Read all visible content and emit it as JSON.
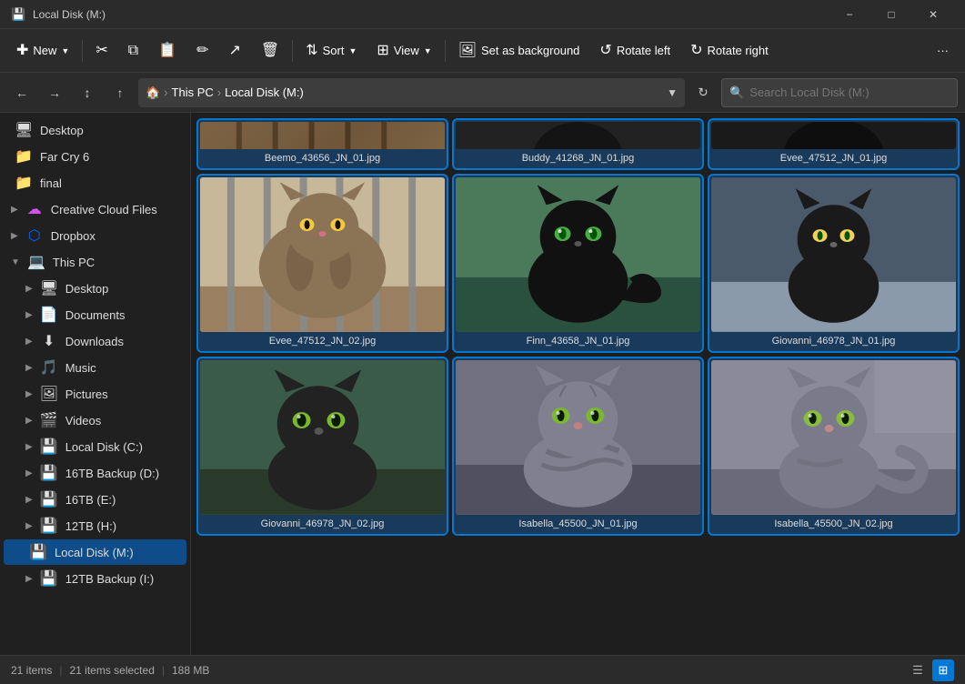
{
  "window": {
    "title": "Local Disk (M:)",
    "icon": "💾"
  },
  "titlebar": {
    "minimize": "−",
    "maximize": "□",
    "close": "✕"
  },
  "toolbar": {
    "new_label": "New",
    "sort_label": "Sort",
    "view_label": "View",
    "set_bg_label": "Set as background",
    "rotate_left_label": "Rotate left",
    "rotate_right_label": "Rotate right",
    "more_label": "···"
  },
  "addressbar": {
    "nav_back": "←",
    "nav_forward": "→",
    "nav_up_disabled": "↑",
    "nav_parent": "⌂",
    "breadcrumb": {
      "root": "⌂",
      "this_pc": "This PC",
      "current": "Local Disk (M:)"
    },
    "search_placeholder": "Search Local Disk (M:)"
  },
  "sidebar": {
    "items": [
      {
        "label": "Desktop",
        "icon": "🖥",
        "type": "folder",
        "indent": 0
      },
      {
        "label": "Far Cry 6",
        "icon": "📁",
        "type": "folder",
        "indent": 0
      },
      {
        "label": "final",
        "icon": "📁",
        "type": "folder",
        "indent": 0
      },
      {
        "label": "Creative Cloud Files",
        "icon": "🟣",
        "type": "cloud",
        "indent": 0,
        "expandable": true
      },
      {
        "label": "Dropbox",
        "icon": "📦",
        "type": "dropbox",
        "indent": 0,
        "expandable": true
      },
      {
        "label": "This PC",
        "icon": "💻",
        "type": "pc",
        "indent": 0,
        "expanded": true
      },
      {
        "label": "Desktop",
        "icon": "🖥",
        "type": "folder",
        "indent": 1,
        "expandable": true
      },
      {
        "label": "Documents",
        "icon": "📄",
        "type": "folder",
        "indent": 1,
        "expandable": true
      },
      {
        "label": "Downloads",
        "icon": "⬇",
        "type": "folder",
        "indent": 1,
        "expandable": true
      },
      {
        "label": "Music",
        "icon": "🎵",
        "type": "folder",
        "indent": 1,
        "expandable": true
      },
      {
        "label": "Pictures",
        "icon": "🖼",
        "type": "folder",
        "indent": 1,
        "expandable": true
      },
      {
        "label": "Videos",
        "icon": "🎬",
        "type": "folder",
        "indent": 1,
        "expandable": true
      },
      {
        "label": "Local Disk (C:)",
        "icon": "💾",
        "type": "drive",
        "indent": 1,
        "expandable": true
      },
      {
        "label": "16TB Backup (D:)",
        "icon": "💾",
        "type": "drive",
        "indent": 1,
        "expandable": true
      },
      {
        "label": "16TB (E:)",
        "icon": "💾",
        "type": "drive",
        "indent": 1,
        "expandable": true
      },
      {
        "label": "12TB (H:)",
        "icon": "💾",
        "type": "drive",
        "indent": 1,
        "expandable": true
      },
      {
        "label": "Local Disk (M:)",
        "icon": "💾",
        "type": "drive",
        "indent": 1,
        "active": true
      },
      {
        "label": "12TB Backup (I:)",
        "icon": "💾",
        "type": "drive",
        "indent": 1,
        "expandable": true
      }
    ]
  },
  "files": [
    {
      "name": "Beemo_43656_JN_01.jpg",
      "cat_class": "cat-1",
      "selected": true,
      "partial": true
    },
    {
      "name": "Buddy_41268_JN_01.jpg",
      "cat_class": "cat-2",
      "selected": true,
      "partial": true
    },
    {
      "name": "Evee_47512_JN_01.jpg",
      "cat_class": "cat-3",
      "selected": true,
      "partial": true
    },
    {
      "name": "Evee_47512_JN_02.jpg",
      "cat_class": "cat-4",
      "selected": true
    },
    {
      "name": "Finn_43658_JN_01.jpg",
      "cat_class": "cat-5",
      "selected": true
    },
    {
      "name": "Giovanni_46978_JN_01.jpg",
      "cat_class": "cat-6",
      "selected": true
    },
    {
      "name": "Giovanni_46978_JN_02.jpg",
      "cat_class": "cat-7",
      "selected": true
    },
    {
      "name": "Isabella_45500_JN_01.jpg",
      "cat_class": "cat-8",
      "selected": true
    },
    {
      "name": "Isabella_45500_JN_02.jpg",
      "cat_class": "cat-9",
      "selected": true
    }
  ],
  "statusbar": {
    "count": "21 items",
    "selected": "21 items selected",
    "size": "188 MB"
  }
}
